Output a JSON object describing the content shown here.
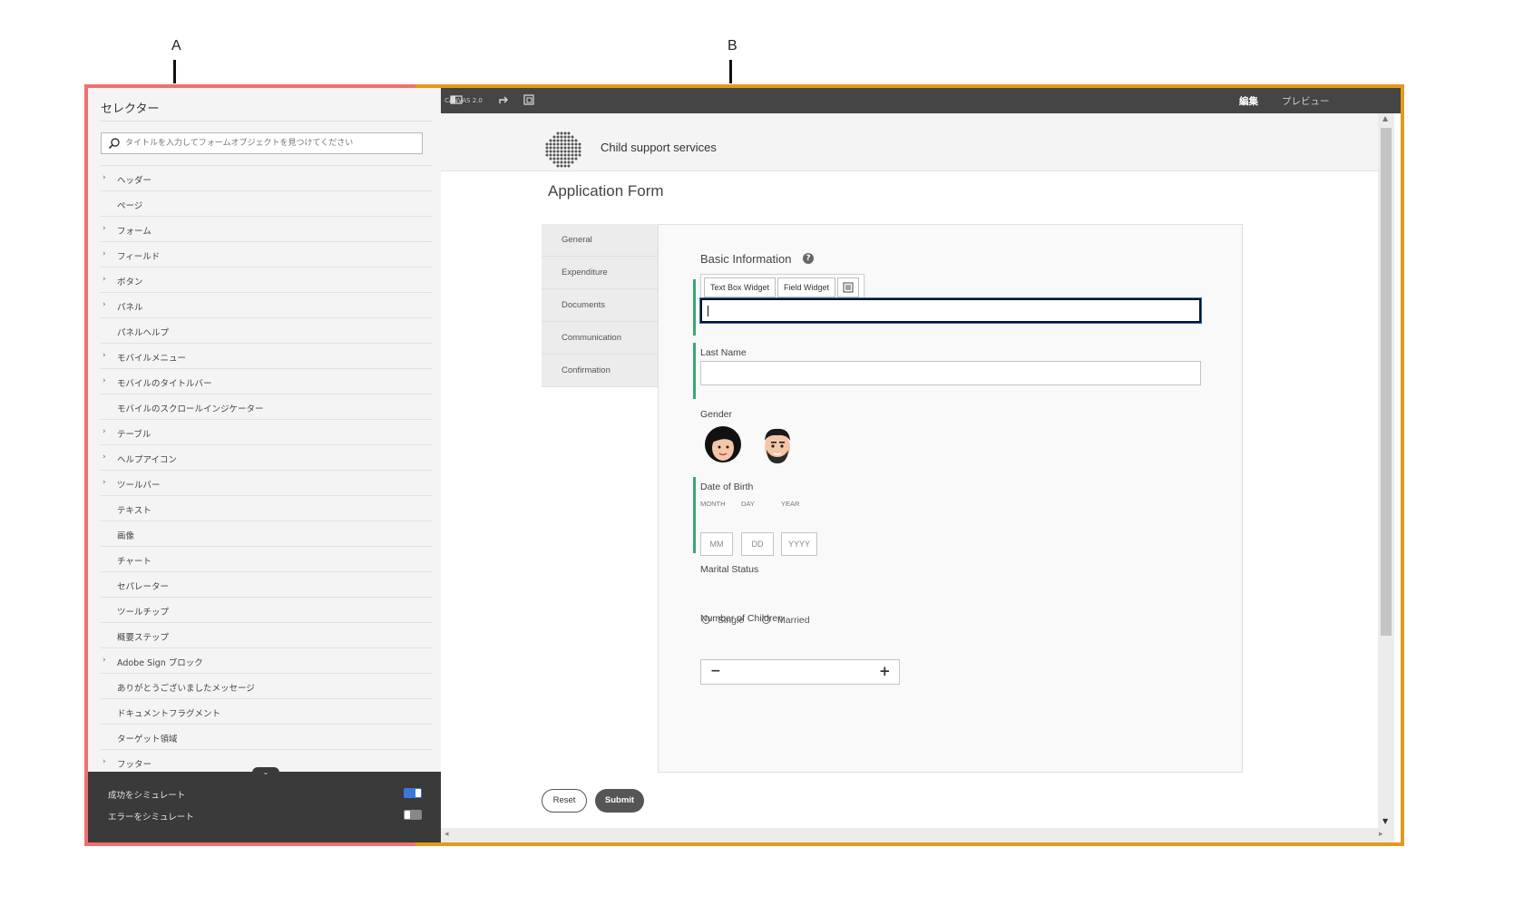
{
  "callouts": {
    "a": "A",
    "b": "B"
  },
  "colors": {
    "frame_a": "#f07070",
    "frame_b": "#e39a1a",
    "accent_green": "#3aa773",
    "toggle_on": "#3c78d8"
  },
  "selector": {
    "title": "セレクター",
    "search_placeholder": "タイトルを入力してフォームオブジェクトを見つけてください",
    "items": [
      {
        "label": "ヘッダー",
        "expandable": true
      },
      {
        "label": "ページ",
        "expandable": false
      },
      {
        "label": "フォーム",
        "expandable": true
      },
      {
        "label": "フィールド",
        "expandable": true
      },
      {
        "label": "ボタン",
        "expandable": true
      },
      {
        "label": "パネル",
        "expandable": true
      },
      {
        "label": "パネルヘルプ",
        "expandable": false
      },
      {
        "label": "モバイルメニュー",
        "expandable": true
      },
      {
        "label": "モバイルのタイトルバー",
        "expandable": true
      },
      {
        "label": "モバイルのスクロールインジケーター",
        "expandable": false
      },
      {
        "label": "テーブル",
        "expandable": true
      },
      {
        "label": "ヘルプアイコン",
        "expandable": true
      },
      {
        "label": "ツールバー",
        "expandable": true
      },
      {
        "label": "テキスト",
        "expandable": false
      },
      {
        "label": "画像",
        "expandable": false
      },
      {
        "label": "チャート",
        "expandable": false
      },
      {
        "label": "セパレーター",
        "expandable": false
      },
      {
        "label": "ツールチップ",
        "expandable": false
      },
      {
        "label": "概要ステップ",
        "expandable": false
      },
      {
        "label": "Adobe Sign ブロック",
        "expandable": true
      },
      {
        "label": "ありがとうございましたメッセージ",
        "expandable": false
      },
      {
        "label": "ドキュメントフラグメント",
        "expandable": false
      },
      {
        "label": "ターゲット領域",
        "expandable": false
      },
      {
        "label": "フッター",
        "expandable": true
      }
    ],
    "simulate_success": {
      "label": "成功をシミュレート",
      "on": true
    },
    "simulate_error": {
      "label": "エラーをシミュレート",
      "on": false
    }
  },
  "toolbar": {
    "breadcrumb": "CANVAS 2.0",
    "edit_label": "編集",
    "preview_label": "プレビュー"
  },
  "site": {
    "name": "Child support services"
  },
  "form": {
    "title": "Application Form",
    "tabs": [
      "General",
      "Expenditure",
      "Documents",
      "Communication",
      "Confirmation"
    ],
    "section_title": "Basic Information",
    "help_icon": "?",
    "widget_buttons": [
      "Text Box Widget",
      "Field Widget"
    ],
    "first_name_value": "",
    "last_name_label": "Last Name",
    "last_name_value": "",
    "gender_label": "Gender",
    "gender_options": [
      "female-avatar",
      "male-avatar"
    ],
    "dob_label": "Date of Birth",
    "dob_sublabels": {
      "month": "MONTH",
      "day": "DAY",
      "year": "YEAR"
    },
    "dob_placeholders": {
      "month": "MM",
      "day": "DD",
      "year": "YYYY"
    },
    "marital_label": "Marital Status",
    "marital_options": [
      "Single",
      "Married"
    ],
    "children_label": "Number of Children",
    "children_minus": "−",
    "children_plus": "+",
    "reset_label": "Reset",
    "submit_label": "Submit"
  }
}
